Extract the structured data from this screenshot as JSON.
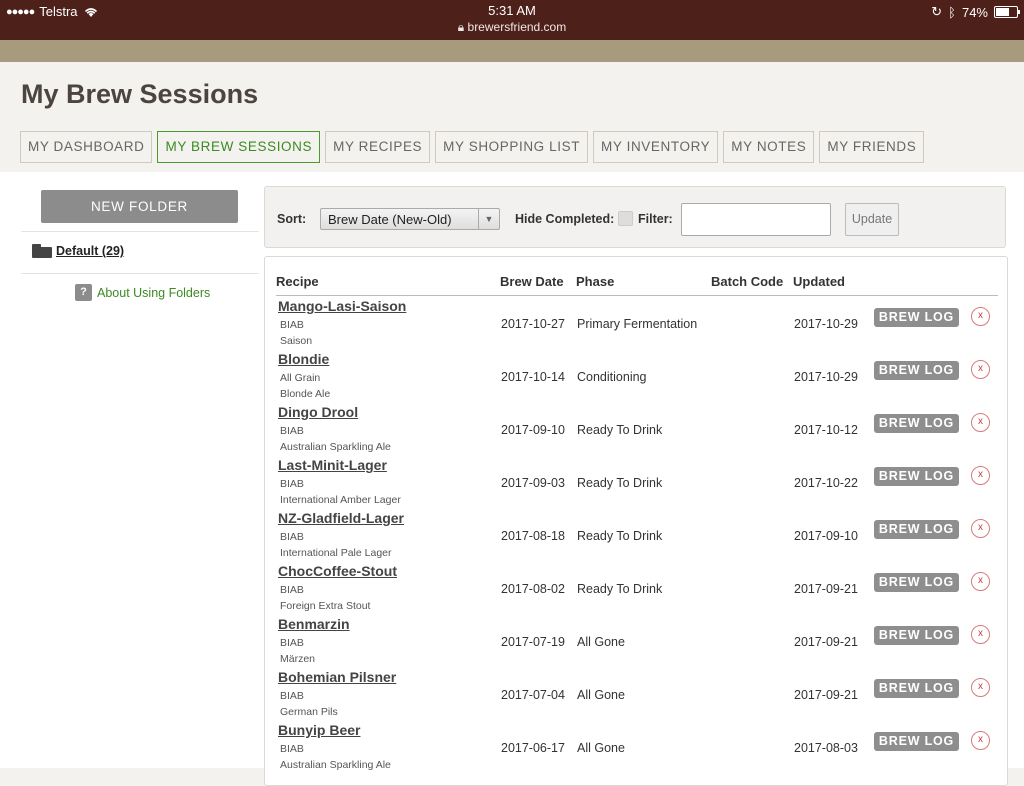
{
  "status_bar": {
    "signal": "●●●●●",
    "carrier": "Telstra",
    "time": "5:31 AM",
    "url": "brewersfriend.com",
    "battery": "74%",
    "battery_level": 0.74
  },
  "page": {
    "title": "My Brew Sessions",
    "tabs": [
      {
        "label": "MY DASHBOARD"
      },
      {
        "label": "MY BREW SESSIONS",
        "active": true
      },
      {
        "label": "MY RECIPES"
      },
      {
        "label": "MY SHOPPING LIST"
      },
      {
        "label": "MY INVENTORY"
      },
      {
        "label": "MY NOTES"
      },
      {
        "label": "MY FRIENDS"
      }
    ]
  },
  "sidebar": {
    "new_folder": "NEW FOLDER",
    "folder": "Default (29)",
    "help_icon": "?",
    "about": "About Using Folders"
  },
  "sortbar": {
    "sort_label": "Sort:",
    "sort_value": "Brew Date (New-Old)",
    "hide_label": "Hide Completed:",
    "hide_checked": false,
    "filter_label": "Filter:",
    "filter_value": "",
    "update": "Update"
  },
  "table": {
    "headers": {
      "recipe": "Recipe",
      "brew_date": "Brew Date",
      "phase": "Phase",
      "batch": "Batch Code",
      "updated": "Updated"
    },
    "brew_log_label": "BREW LOG",
    "delete_label": "x",
    "rows": [
      {
        "name": "Mango-Lasi-Saison",
        "method": "BIAB",
        "style": "Saison",
        "brew_date": "2017-10-27",
        "phase": "Primary Fermentation",
        "batch": "",
        "updated": "2017-10-29"
      },
      {
        "name": "Blondie",
        "method": "All Grain",
        "style": "Blonde Ale",
        "brew_date": "2017-10-14",
        "phase": "Conditioning",
        "batch": "",
        "updated": "2017-10-29"
      },
      {
        "name": "Dingo Drool",
        "method": "BIAB",
        "style": "Australian Sparkling Ale",
        "brew_date": "2017-09-10",
        "phase": "Ready To Drink",
        "batch": "",
        "updated": "2017-10-12"
      },
      {
        "name": "Last-Minit-Lager",
        "method": "BIAB",
        "style": "International Amber Lager",
        "brew_date": "2017-09-03",
        "phase": "Ready To Drink",
        "batch": "",
        "updated": "2017-10-22"
      },
      {
        "name": "NZ-Gladfield-Lager",
        "method": "BIAB",
        "style": "International Pale Lager",
        "brew_date": "2017-08-18",
        "phase": "Ready To Drink",
        "batch": "",
        "updated": "2017-09-10"
      },
      {
        "name": "ChocCoffee-Stout",
        "method": "BIAB",
        "style": "Foreign Extra Stout",
        "brew_date": "2017-08-02",
        "phase": "Ready To Drink",
        "batch": "",
        "updated": "2017-09-21"
      },
      {
        "name": "Benmarzin",
        "method": "BIAB",
        "style": "Märzen",
        "brew_date": "2017-07-19",
        "phase": "All Gone",
        "batch": "",
        "updated": "2017-09-21"
      },
      {
        "name": "Bohemian Pilsner",
        "method": "BIAB",
        "style": "German Pils",
        "brew_date": "2017-07-04",
        "phase": "All Gone",
        "batch": "",
        "updated": "2017-09-21"
      },
      {
        "name": "Bunyip Beer",
        "method": "BIAB",
        "style": "Australian Sparkling Ale",
        "brew_date": "2017-06-17",
        "phase": "All Gone",
        "batch": "",
        "updated": "2017-08-03"
      }
    ]
  },
  "colors": {
    "status_bar": "#4e201a",
    "brand_bar": "#a89a7c",
    "accent_green": "#3c8a24",
    "button_gray": "#8e8e8e",
    "delete_red": "#c83c3c"
  }
}
